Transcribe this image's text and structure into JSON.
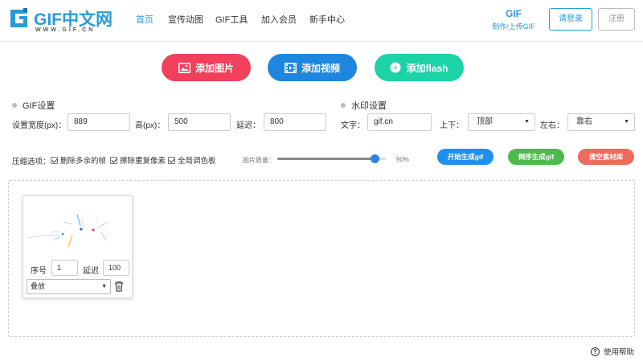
{
  "header": {
    "logo_title": "GIF中文网",
    "logo_sub": "WWW.GIF.CN",
    "nav": [
      "首页",
      "宣传动图",
      "GIF工具",
      "加入会员",
      "新手中心"
    ],
    "gif_tool_title": "GIF",
    "gif_tool_sub": "制作/上传GIF",
    "login_label": "请登录",
    "register_label": "注册"
  },
  "add_buttons": {
    "image": "添加图片",
    "video": "添加视频",
    "flash": "添加flash"
  },
  "gif_settings": {
    "title": "GIF设置",
    "width_label": "设置宽度(px)：",
    "width_value": "889",
    "height_label": "高(px)：",
    "height_value": "500",
    "delay_label": "延迟：",
    "delay_value": "800"
  },
  "watermark_settings": {
    "title": "水印设置",
    "text_label": "文字：",
    "text_value": "gif.cn",
    "vertical_label": "上下：",
    "vertical_value": "顶部",
    "horizontal_label": "左右：",
    "horizontal_value": "靠右"
  },
  "compress": {
    "label": "压缩选项：",
    "options": [
      "删除多余的帧",
      "擦除重复像素",
      "全局调色板"
    ],
    "quality_label": "图片质量：",
    "quality_value": "90%",
    "quality_fraction": 0.9
  },
  "actions": {
    "start": "开始生成gif",
    "reverse": "倒序生成gif",
    "clear": "清空素材库"
  },
  "frame_card": {
    "index_label": "序号",
    "index_value": "1",
    "delay_label": "延迟",
    "delay_value": "100",
    "mode_value": "叠放"
  },
  "help_label": "使用帮助",
  "colors": {
    "brand": "#2a9bd6",
    "image_btn": "#f0405c",
    "video_btn": "#1f86e0",
    "flash_btn": "#1bd3a6",
    "start_btn": "#1e90f0",
    "reverse_btn": "#4cbb4a",
    "clear_btn": "#ee6b5d"
  }
}
